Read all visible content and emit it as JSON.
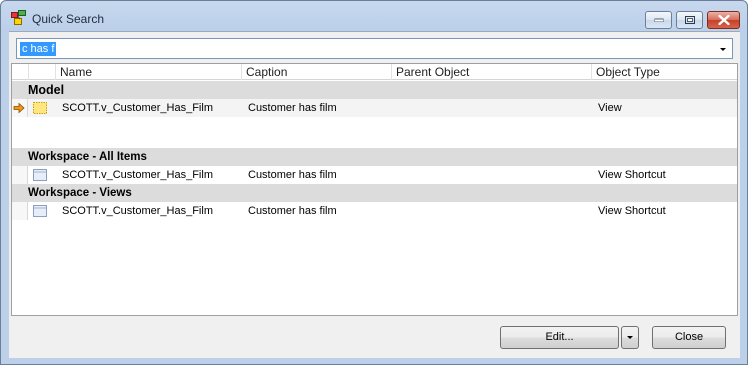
{
  "window": {
    "title": "Quick Search"
  },
  "search": {
    "value": "c has f"
  },
  "grid": {
    "columns": [
      "Name",
      "Caption",
      "Parent Object",
      "Object Type"
    ],
    "groups": [
      {
        "label": "Model",
        "rows": [
          {
            "name": "SCOTT.v_Customer_Has_Film",
            "caption": "Customer has film",
            "parent": "",
            "type": "View",
            "current": true,
            "icon": "view-icon"
          }
        ]
      },
      {
        "label": "Workspace - All Items",
        "rows": [
          {
            "name": "SCOTT.v_Customer_Has_Film",
            "caption": "Customer has film",
            "parent": "",
            "type": "View Shortcut",
            "current": false,
            "icon": "view-shortcut-icon"
          }
        ]
      },
      {
        "label": "Workspace - Views",
        "rows": [
          {
            "name": "SCOTT.v_Customer_Has_Film",
            "caption": "Customer has film",
            "parent": "",
            "type": "View Shortcut",
            "current": false,
            "icon": "view-shortcut-icon"
          }
        ]
      }
    ]
  },
  "buttons": {
    "edit_label": "Edit...",
    "close_label": "Close"
  }
}
